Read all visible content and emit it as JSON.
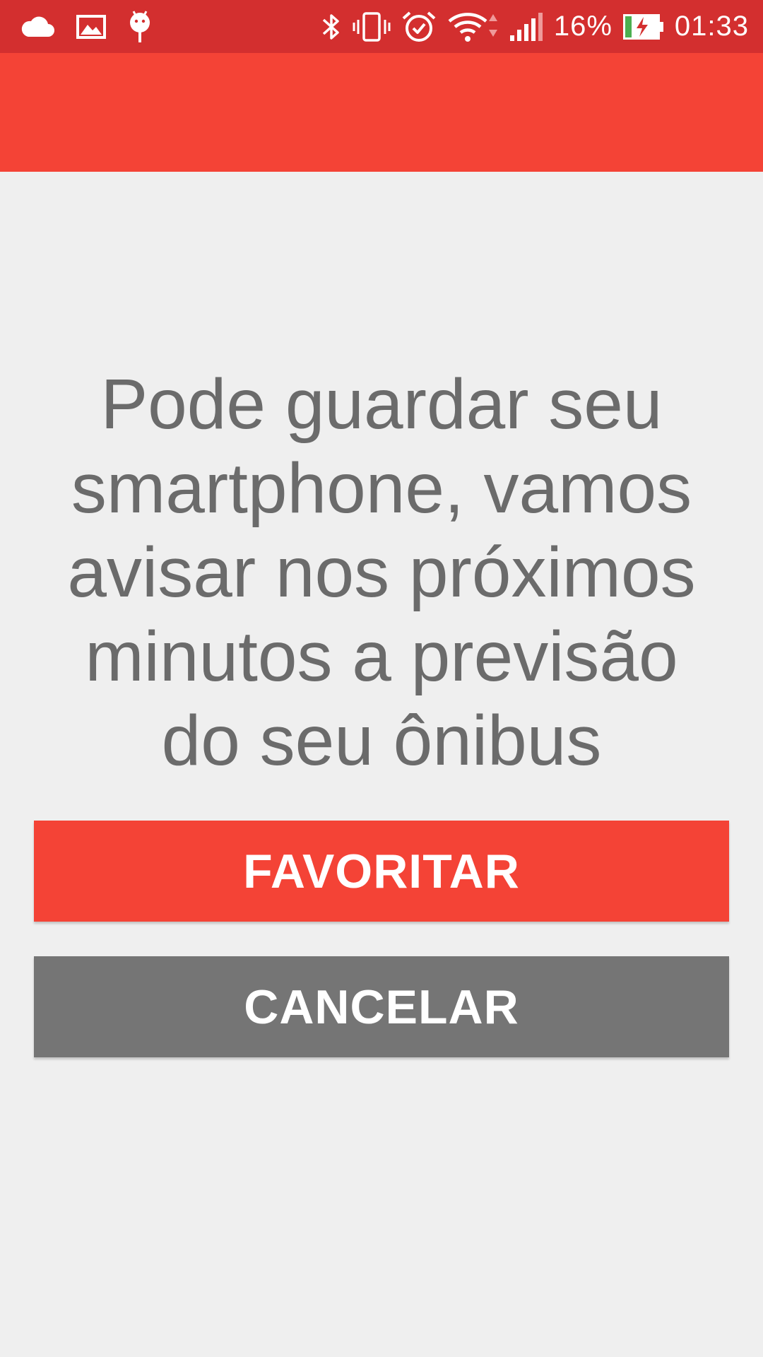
{
  "colors": {
    "status_bar": "#d32f2f",
    "app_bar": "#f44336",
    "background": "#efefef",
    "message_text": "#6b6b6b",
    "primary_button": "#f44336",
    "secondary_button": "#757575"
  },
  "status_bar": {
    "left_icons": [
      "cloud-icon",
      "image-icon",
      "android-icon"
    ],
    "right_icons": [
      "bluetooth-icon",
      "vibrate-icon",
      "alarm-icon",
      "wifi-icon",
      "signal-icon",
      "battery-charging-icon"
    ],
    "battery_percent": "16%",
    "time": "01:33"
  },
  "main": {
    "message": "Pode guardar seu smartphone, vamos avisar nos próximos minutos a previsão do seu ônibus",
    "favorite_button_label": "FAVORITAR",
    "cancel_button_label": "CANCELAR"
  }
}
